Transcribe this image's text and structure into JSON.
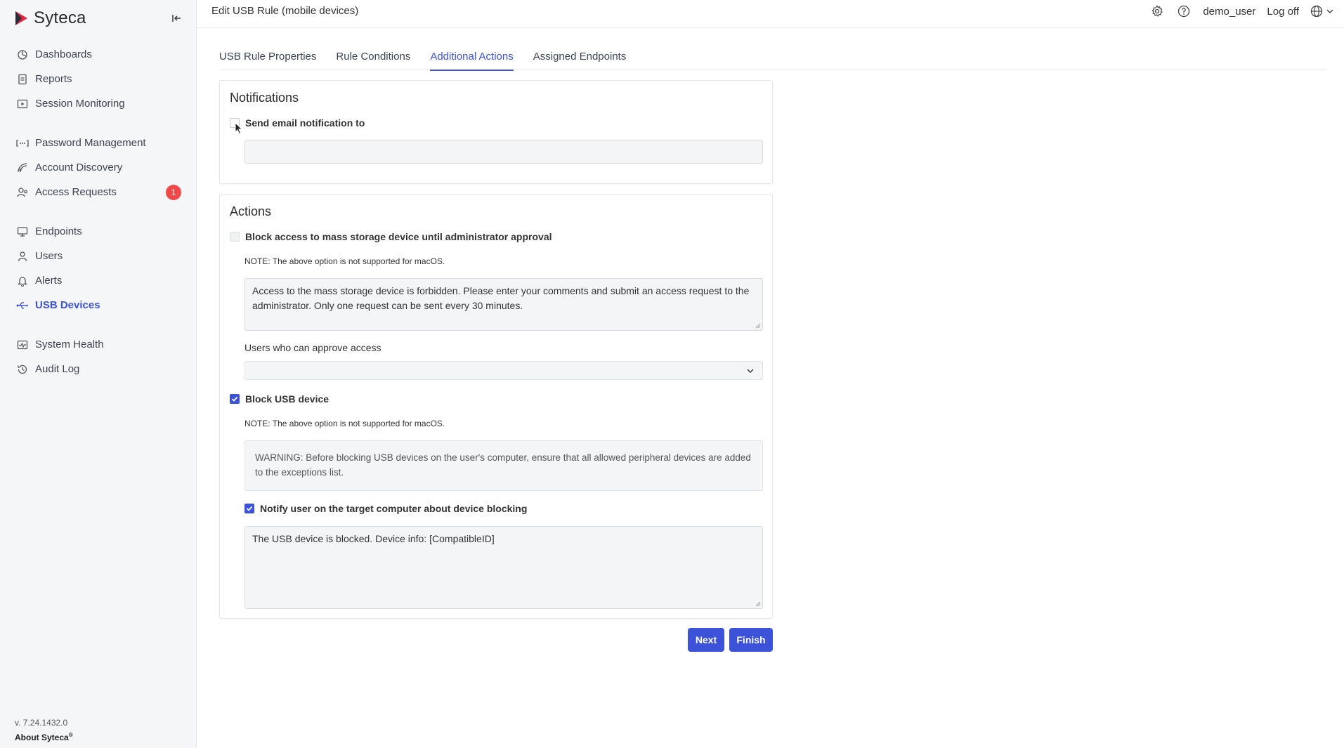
{
  "app": {
    "brand": "Syteca",
    "version": "v. 7.24.1432.0",
    "about": "About Syteca",
    "about_mark": "®"
  },
  "sidebar": {
    "items": [
      {
        "label": "Dashboards",
        "icon": "dashboard-icon"
      },
      {
        "label": "Reports",
        "icon": "document-icon"
      },
      {
        "label": "Session Monitoring",
        "icon": "play-icon"
      },
      {
        "label": "Password Management",
        "icon": "password-dots-icon"
      },
      {
        "label": "Account Discovery",
        "icon": "radar-icon"
      },
      {
        "label": "Access Requests",
        "icon": "user-key-icon",
        "badge": "1"
      },
      {
        "label": "Endpoints",
        "icon": "monitor-icon"
      },
      {
        "label": "Users",
        "icon": "user-icon"
      },
      {
        "label": "Alerts",
        "icon": "bell-icon"
      },
      {
        "label": "USB Devices",
        "icon": "usb-icon",
        "active": true
      },
      {
        "label": "System Health",
        "icon": "health-icon"
      },
      {
        "label": "Audit Log",
        "icon": "history-icon"
      }
    ]
  },
  "header": {
    "title": "Edit USB Rule (mobile devices)",
    "user": "demo_user",
    "logoff": "Log off"
  },
  "tabs": [
    {
      "label": "USB Rule Properties"
    },
    {
      "label": "Rule Conditions"
    },
    {
      "label": "Additional Actions",
      "active": true
    },
    {
      "label": "Assigned Endpoints"
    }
  ],
  "notifications": {
    "title": "Notifications",
    "send_email_label": "Send email notification to",
    "send_email_checked": false,
    "email_value": ""
  },
  "actions": {
    "title": "Actions",
    "block_access_label": "Block access to mass storage device until administrator approval",
    "block_access_checked": false,
    "note1": "NOTE: The above option is not supported for macOS.",
    "block_message": "Access to the mass storage device is forbidden. Please enter your comments and submit an access request to the administrator. Only one request can be sent every 30 minutes.",
    "approvers_label": "Users who can approve access",
    "approvers_value": "",
    "block_usb_label": "Block USB device",
    "block_usb_checked": true,
    "note2": "NOTE: The above option is not supported for macOS.",
    "warning": "WARNING: Before blocking USB devices on the user's computer, ensure that all allowed peripheral devices are added to the exceptions list.",
    "notify_label": "Notify user on the target computer about device blocking",
    "notify_checked": true,
    "notify_message": "The USB device is blocked. Device info: [CompatibleID]"
  },
  "buttons": {
    "next": "Next",
    "finish": "Finish"
  },
  "colors": {
    "accent": "#3b52d9",
    "badge": "#ef4949",
    "sidebar_bg": "#f5f6f7"
  }
}
